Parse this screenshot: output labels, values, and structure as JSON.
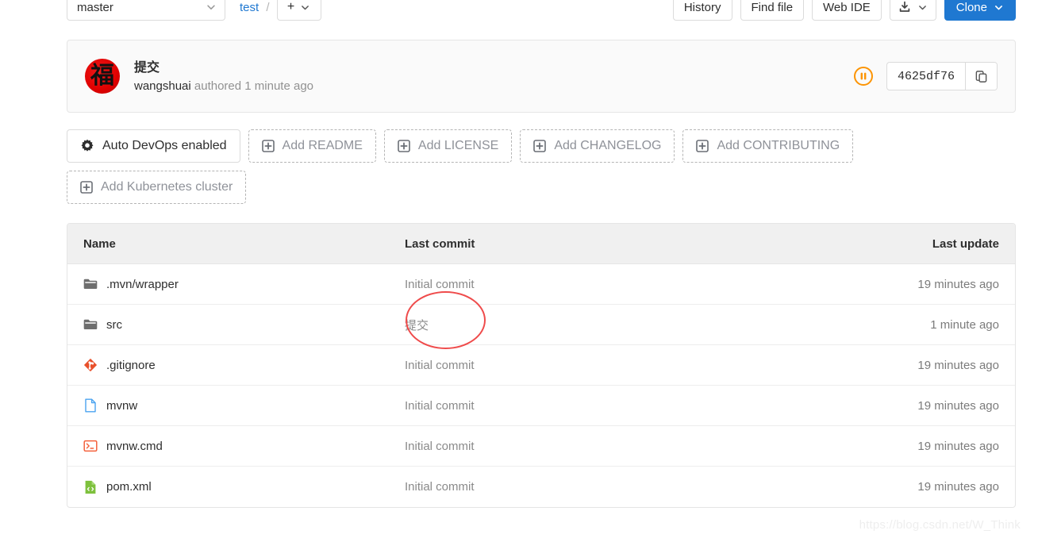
{
  "toolbar": {
    "branch": "master",
    "breadcrumb_project": "test",
    "breadcrumb_separator": "/",
    "plus_label": "+",
    "history_label": "History",
    "find_file_label": "Find file",
    "web_ide_label": "Web IDE",
    "clone_label": "Clone",
    "download_icon": "download-icon",
    "chevron_icon": "chevron-down-icon",
    "clone_color": "#1f78d1"
  },
  "commit": {
    "avatar_glyph": "福",
    "avatar_color": "#e00000",
    "title": "提交",
    "author": "wangshuai",
    "authored_text": "authored",
    "time": "1 minute ago",
    "sha": "4625df76",
    "copy_icon": "copy-icon",
    "status_icon": "pause-status-icon",
    "status_color": "#fc9403"
  },
  "chips": {
    "row1": [
      {
        "label": "Auto DevOps enabled",
        "icon": "gear-icon",
        "style": "solid"
      },
      {
        "label": "Add README",
        "icon": "plus-square-icon",
        "style": "dashed"
      },
      {
        "label": "Add LICENSE",
        "icon": "plus-square-icon",
        "style": "dashed"
      },
      {
        "label": "Add CHANGELOG",
        "icon": "plus-square-icon",
        "style": "dashed"
      },
      {
        "label": "Add CONTRIBUTING",
        "icon": "plus-square-icon",
        "style": "dashed"
      }
    ],
    "row2": [
      {
        "label": "Add Kubernetes cluster",
        "icon": "plus-square-icon",
        "style": "dashed"
      }
    ]
  },
  "table": {
    "headers": {
      "name": "Name",
      "last_commit": "Last commit",
      "last_update": "Last update"
    },
    "rows": [
      {
        "name": ".mvn/wrapper",
        "icon": "folder-icon",
        "last_commit": "Initial commit",
        "last_update": "19 minutes ago"
      },
      {
        "name": "src",
        "icon": "folder-icon",
        "last_commit": "提交",
        "last_update": "1 minute ago"
      },
      {
        "name": ".gitignore",
        "icon": "git-file-icon",
        "last_commit": "Initial commit",
        "last_update": "19 minutes ago"
      },
      {
        "name": "mvnw",
        "icon": "text-file-icon",
        "last_commit": "Initial commit",
        "last_update": "19 minutes ago"
      },
      {
        "name": "mvnw.cmd",
        "icon": "console-file-icon",
        "last_commit": "Initial commit",
        "last_update": "19 minutes ago"
      },
      {
        "name": "pom.xml",
        "icon": "xml-file-icon",
        "last_commit": "Initial commit",
        "last_update": "19 minutes ago"
      }
    ]
  },
  "annotation": {
    "shape": "ellipse",
    "color": "#ef4b4b",
    "target": "src-last-commit"
  },
  "watermark": {
    "text": "https://blog.csdn.net/W_Think"
  }
}
